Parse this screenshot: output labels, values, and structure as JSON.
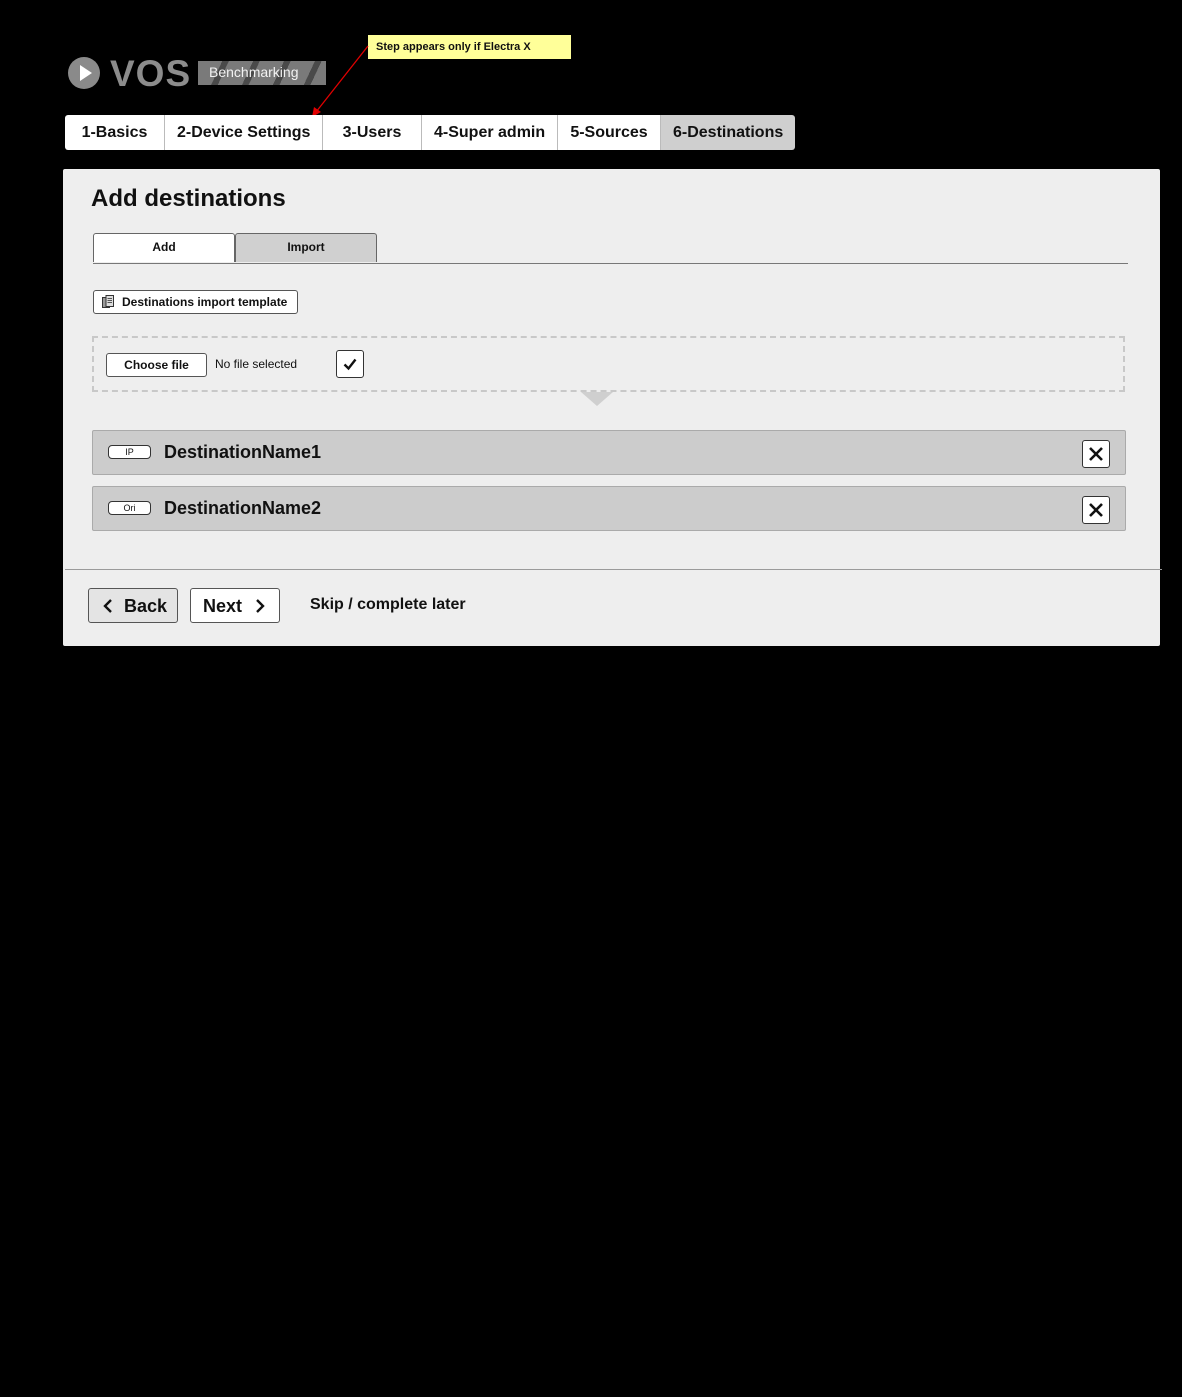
{
  "logo": {
    "name": "VOS",
    "subtitle": "Benchmarking"
  },
  "annotation": {
    "text": "Step appears only if Electra X"
  },
  "steps": [
    {
      "label": "1-Basics"
    },
    {
      "label": "2-Device Settings"
    },
    {
      "label": "3-Users"
    },
    {
      "label": "4-Super admin"
    },
    {
      "label": "5-Sources"
    },
    {
      "label": "6-Destinations",
      "active": true
    }
  ],
  "panel": {
    "title": "Add destinations",
    "tabs": [
      {
        "label": "Add"
      },
      {
        "label": "Import",
        "active": true
      }
    ],
    "template_button": "Destinations import template",
    "file": {
      "button": "Choose file",
      "status": "No file selected"
    },
    "destinations": [
      {
        "type": "IP",
        "name": "DestinationName1"
      },
      {
        "type": "Ori",
        "name": "DestinationName2"
      }
    ]
  },
  "footer": {
    "back": "Back",
    "next": "Next",
    "skip": "Skip / complete later"
  },
  "icons": {
    "logo": "play-circle-icon",
    "template": "document-icon",
    "confirm": "checkmark-icon",
    "remove": "close-icon",
    "back": "chevron-left-icon",
    "next": "chevron-right-icon"
  },
  "colors": {
    "background": "#000000",
    "panel": "#eeeeee",
    "active_tab": "#cfcfcf",
    "annotation": "#ffff99",
    "arrow": "#e00000"
  }
}
